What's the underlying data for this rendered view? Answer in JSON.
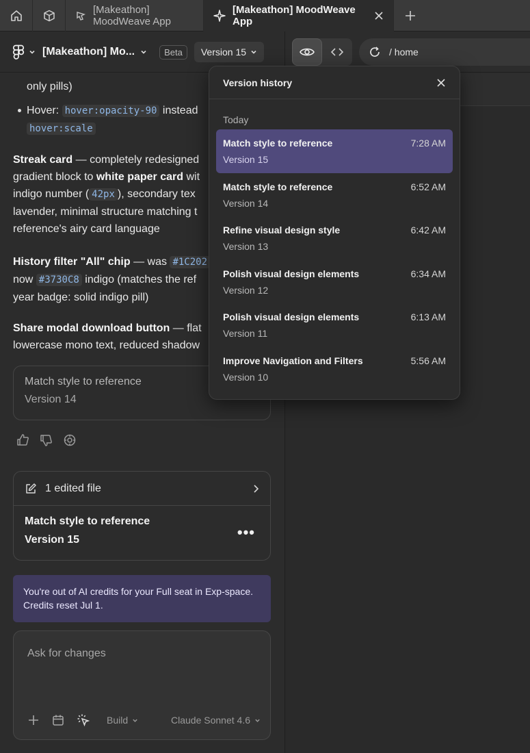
{
  "tabs": {
    "file_tab_label": "[Makeathon] MoodWeave App",
    "active_tab_label": "[Makeathon] MoodWeave App"
  },
  "toolbar": {
    "project_title": "[Makeathon] Mo...",
    "beta_label": "Beta",
    "version_label": "Version 15",
    "url_path": "/ home"
  },
  "chat": {
    "p0_line1": "only pills)",
    "p1_prefix": "Hover:",
    "p1_code1": "hover:opacity-90",
    "p1_mid": "instead",
    "p1_code2": "hover:scale",
    "p2_b1": "Streak card",
    "p2_t1": " — completely redesigned",
    "p2_t2": "gradient block to ",
    "p2_b2": "white paper card",
    "p2_t3": " wit",
    "p2_t4": "indigo number (",
    "p2_code": "42px",
    "p2_t5": "), secondary tex",
    "p2_t6": "lavender, minimal structure matching t",
    "p2_t7": "reference's airy card language",
    "p3_b1": "History filter \"All\" chip",
    "p3_t1": " — was ",
    "p3_code1": "#1C202",
    "p3_t2": "now ",
    "p3_code2": "#3730C8",
    "p3_t3": " indigo (matches the ref",
    "p3_t4": "year badge: solid indigo pill)",
    "p4_b1": "Share modal download button",
    "p4_t1": " — flat",
    "p4_t2": "lowercase mono text, reduced shadow",
    "version_card": {
      "title": "Match style to reference",
      "version": "Version 14"
    },
    "edit_card": {
      "edited_label": "1 edited file",
      "title": "Match style to reference",
      "version": "Version 15",
      "more": "•••"
    },
    "credits_notice": "You're out of AI credits for your Full seat in Exp-space. Credits reset Jul 1.",
    "composer": {
      "placeholder": "Ask for changes",
      "mode_label": "Build",
      "model_label": "Claude Sonnet 4.6"
    }
  },
  "version_history": {
    "title": "Version history",
    "section": "Today",
    "items": [
      {
        "name": "Match style to reference",
        "version": "Version 15",
        "time": "7:28 AM",
        "selected": true
      },
      {
        "name": "Match style to reference",
        "version": "Version 14",
        "time": "6:52 AM"
      },
      {
        "name": "Refine visual design style",
        "version": "Version 13",
        "time": "6:42 AM"
      },
      {
        "name": "Polish visual design elements",
        "version": "Version 12",
        "time": "6:34 AM"
      },
      {
        "name": "Polish visual design elements",
        "version": "Version 11",
        "time": "6:13 AM"
      },
      {
        "name": "Improve Navigation and Filters",
        "version": "Version 10",
        "time": "5:56 AM"
      }
    ]
  },
  "colors": {
    "selected_version": "#504a7c",
    "credits_bg": "#3f3a5e",
    "code_text": "#8fb7e6"
  }
}
